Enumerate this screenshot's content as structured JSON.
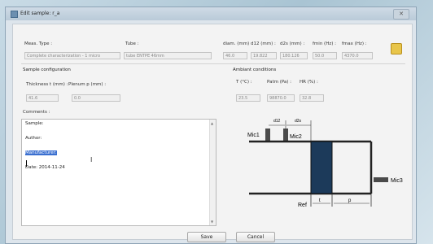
{
  "window": {
    "title": "Edit sample: r_a"
  },
  "top_labels": {
    "meas_type": "Meas. Type :",
    "tube": "Tube :",
    "diam": "diam. (mm)",
    "d12": "d12 (mm) :",
    "d2s": "d2s (mm) :",
    "fmin": "fmin (Hz) :",
    "fmax": "fmax (Hz) :"
  },
  "top_values": {
    "meas_type": "Complete characterization - 1 micro",
    "tube": "tube ENTPE 46mm",
    "diam": "46.0",
    "d12": "19.822",
    "d2s": "180.126",
    "fmin": "50.0",
    "fmax": "4370.0"
  },
  "sample_config": {
    "title": "Sample configuration",
    "thickness_label": "Thickness t (mm) :",
    "plenum_label": "Plenum p (mm) :",
    "thickness_value": "41.6",
    "plenum_value": "0.0"
  },
  "ambient": {
    "title": "Ambiant conditions",
    "temp_label": "T (°C) :",
    "patm_label": "Patm (Pa) :",
    "hr_label": "HR (%) :",
    "temp_value": "23.5",
    "patm_value": "98870.0",
    "hr_value": "32.8"
  },
  "comments": {
    "label": "Comments :",
    "lines": [
      "Sample:",
      "Author:",
      "Manufacturer:",
      "Date: 2014-11-24"
    ]
  },
  "diagram": {
    "mic1": "Mic1",
    "mic2": "Mic2",
    "mic3": "Mic3",
    "ref": "Ref",
    "d12": "d12",
    "d2s": "d2s",
    "t": "t",
    "p": "p"
  },
  "buttons": {
    "save": "Save",
    "cancel": "Cancel"
  },
  "colors": {
    "sample": "#1c3a5a",
    "selection": "#3a6fd0"
  }
}
